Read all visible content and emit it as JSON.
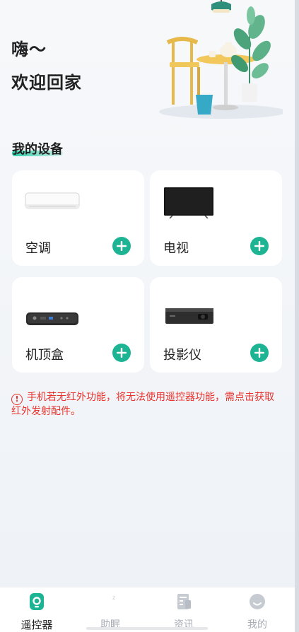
{
  "greeting": {
    "line1": "嗨～",
    "line2": "欢迎回家"
  },
  "section": {
    "title": "我的设备"
  },
  "devices": [
    {
      "label": "空调",
      "icon": "air-conditioner-image"
    },
    {
      "label": "电视",
      "icon": "tv-image"
    },
    {
      "label": "机顶盒",
      "icon": "set-top-box-image"
    },
    {
      "label": "投影仪",
      "icon": "projector-image"
    }
  ],
  "notice": {
    "text": "手机若无红外功能，将无法使用遥控器功能，需点击获取红外发射配件。",
    "icon": "!"
  },
  "tabs": [
    {
      "label": "遥控器",
      "icon": "remote-icon",
      "active": true
    },
    {
      "label": "助眠",
      "icon": "moon-icon",
      "active": false
    },
    {
      "label": "资讯",
      "icon": "news-icon",
      "active": false
    },
    {
      "label": "我的",
      "icon": "profile-icon",
      "active": false
    }
  ],
  "colors": {
    "accent": "#1db494",
    "warning": "#e8342d",
    "background": "#f0f3f8"
  }
}
